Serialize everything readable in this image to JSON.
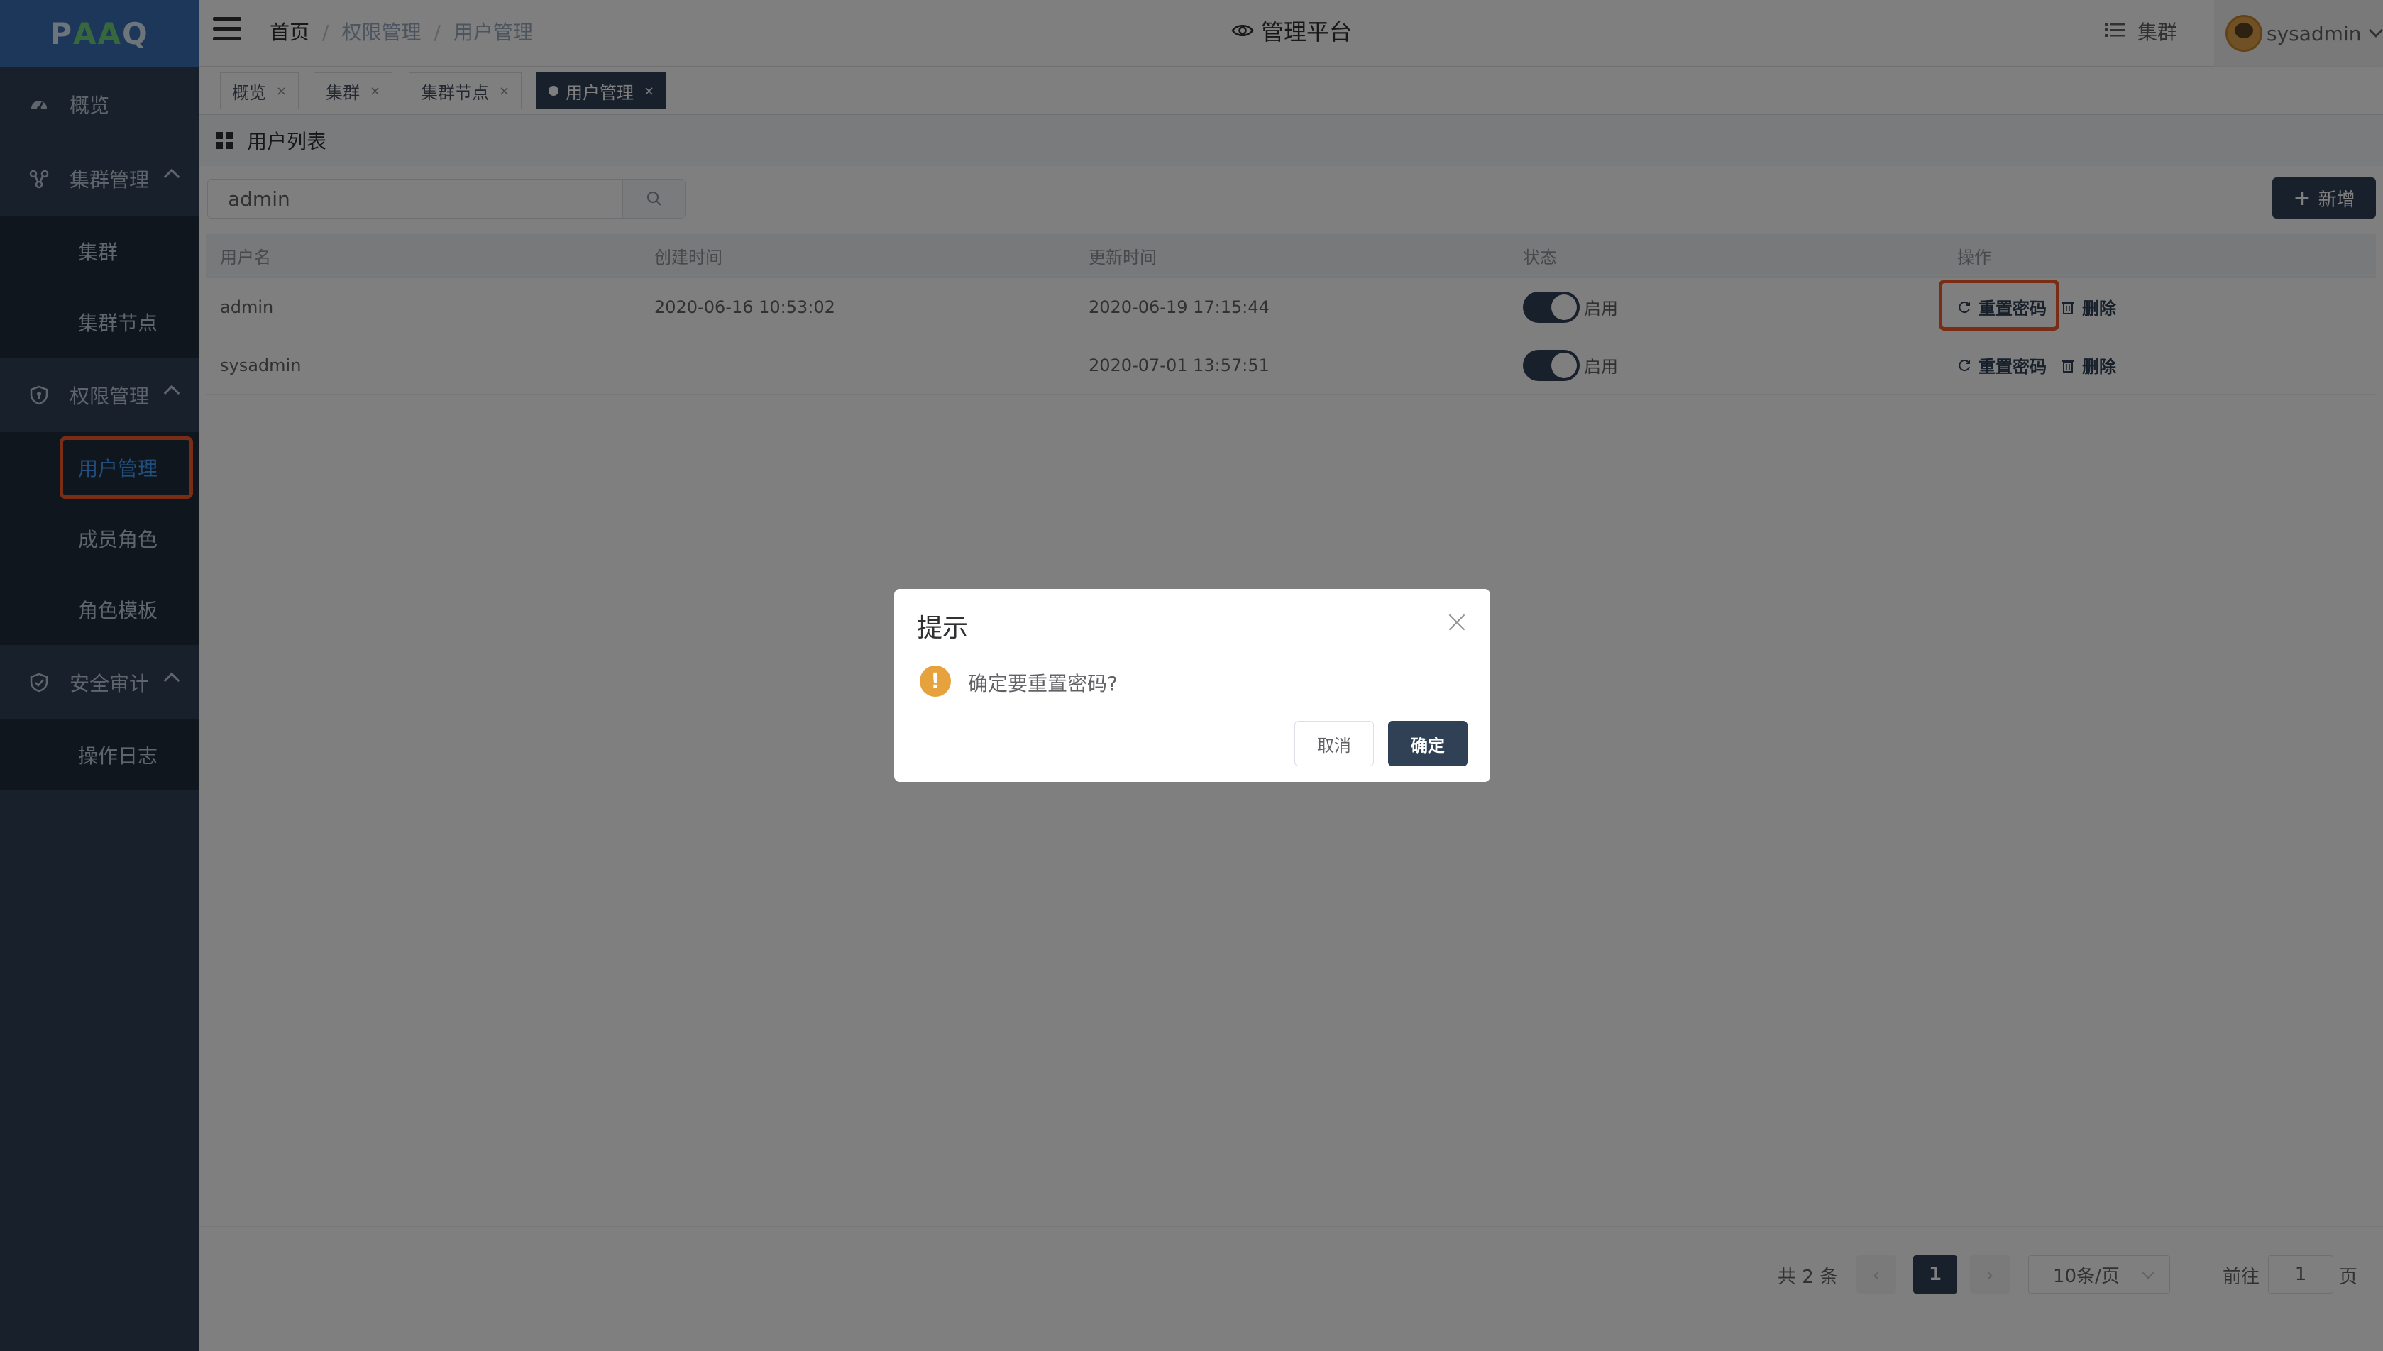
{
  "app": {
    "logo": {
      "p": "P",
      "mid": "AA",
      "q": "Q"
    },
    "title": "管理平台"
  },
  "sidebar": {
    "items": [
      {
        "label": "概览",
        "icon": "dashboard-icon"
      },
      {
        "label": "集群管理",
        "icon": "cluster-icon",
        "children": [
          "集群",
          "集群节点"
        ]
      },
      {
        "label": "权限管理",
        "icon": "shield-icon",
        "children": [
          "用户管理",
          "成员角色",
          "角色模板"
        ]
      },
      {
        "label": "安全审计",
        "icon": "audit-shield-icon",
        "children": [
          "操作日志"
        ]
      }
    ],
    "active": "用户管理"
  },
  "header": {
    "breadcrumb": [
      "首页",
      "权限管理",
      "用户管理"
    ],
    "separator": "/",
    "cluster_label": "集群",
    "username": "sysadmin"
  },
  "tags": [
    {
      "label": "概览",
      "close": "×"
    },
    {
      "label": "集群",
      "close": "×"
    },
    {
      "label": "集群节点",
      "close": "×"
    },
    {
      "label": "用户管理",
      "close": "×",
      "active": true
    }
  ],
  "main": {
    "card_title": "用户列表",
    "search_value": "admin",
    "add_label": "新增",
    "add_icon": "+",
    "columns": [
      "用户名",
      "创建时间",
      "更新时间",
      "状态",
      "操作"
    ],
    "rows": [
      {
        "username": "admin",
        "created": "2020-06-16 10:53:02",
        "updated": "2020-06-19 17:15:44",
        "status": "启用",
        "enabled": true
      },
      {
        "username": "sysadmin",
        "created": "",
        "updated": "2020-07-01 13:57:51",
        "status": "启用",
        "enabled": true
      }
    ],
    "actions": {
      "reset": "重置密码",
      "delete": "删除"
    }
  },
  "pagination": {
    "total": "共 2 条",
    "prev": "‹",
    "next": "›",
    "current": "1",
    "page_size": "10条/页",
    "goto": "前往",
    "goto_value": "1",
    "page_suffix": "页"
  },
  "dialog": {
    "title": "提示",
    "warn_icon": "!",
    "message": "确定要重置密码?",
    "cancel": "取消",
    "confirm": "确定"
  },
  "colors": {
    "sidebar_bg": "#304156",
    "submenu_bg": "#1f2d3d",
    "active_text": "#409eff",
    "primary_button": "#304156",
    "highlight_box": "#f25a2a",
    "warning": "#e6a23c"
  }
}
